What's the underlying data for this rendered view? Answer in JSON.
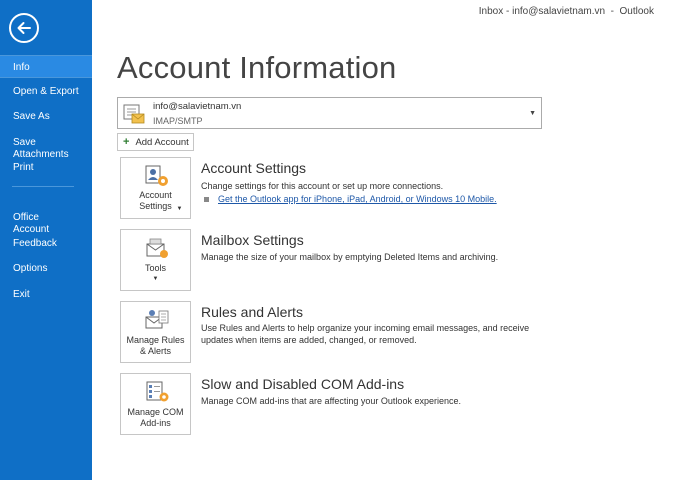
{
  "window": {
    "title": "Inbox - info@salavietnam.vn  -  Outlook"
  },
  "colors": {
    "sidebar": "#0f6fc6",
    "active": "#2a8ae3",
    "link": "#1e58a8"
  },
  "sidebar": {
    "back_icon": "back-arrow-icon",
    "items": [
      {
        "label": "Info",
        "active": true
      },
      {
        "label": "Open & Export"
      },
      {
        "label": "Save As"
      },
      {
        "label": "Save Attachments"
      },
      {
        "label": "Print"
      },
      {
        "label": "Office\nAccount"
      },
      {
        "label": "Feedback"
      },
      {
        "label": "Options"
      },
      {
        "label": "Exit"
      }
    ]
  },
  "main": {
    "title": "Account Information",
    "account": {
      "email": "info@salavietnam.vn",
      "type": "IMAP/SMTP"
    },
    "add_account": "Add Account",
    "sections": [
      {
        "tile_label": "Account\nSettings",
        "has_caret": true,
        "icon": "account-settings-icon",
        "title": "Account Settings",
        "description": "Change settings for this account or set up more connections.",
        "link": "Get the Outlook app for iPhone, iPad, Android, or Windows 10 Mobile."
      },
      {
        "tile_label": "Tools",
        "has_caret": true,
        "icon": "tools-icon",
        "title": "Mailbox Settings",
        "description": "Manage the size of your mailbox by emptying Deleted Items and archiving."
      },
      {
        "tile_label": "Manage Rules\n& Alerts",
        "icon": "rules-alerts-icon",
        "title": "Rules and Alerts",
        "description": "Use Rules and Alerts to help organize your incoming email messages, and receive updates when items are added, changed, or removed."
      },
      {
        "tile_label": "Manage COM\nAdd-ins",
        "icon": "com-addins-icon",
        "title": "Slow and Disabled COM Add-ins",
        "description": "Manage COM add-ins that are affecting your Outlook experience."
      }
    ]
  }
}
